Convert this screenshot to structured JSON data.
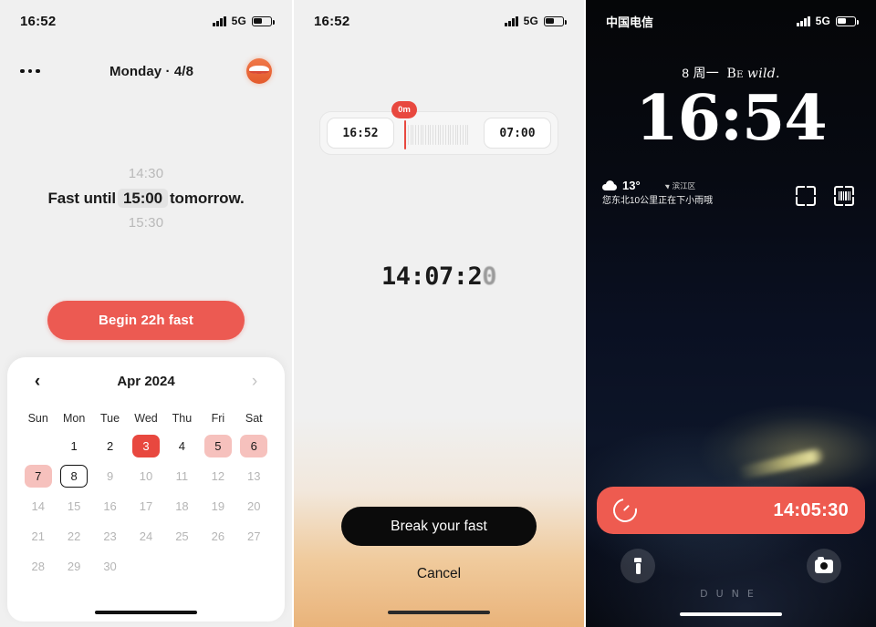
{
  "panel1": {
    "status": {
      "time": "16:52",
      "network": "5G"
    },
    "topbar": {
      "menu_icon": "more-dots-icon",
      "date": "Monday · 4/8",
      "avatar_icon": "profile-avatar"
    },
    "fast_line": {
      "ghost_above": "14:30",
      "prefix": "Fast until",
      "selected_time": "15:00",
      "suffix": "tomorrow.",
      "ghost_below": "15:30"
    },
    "begin_button": "Begin 22h fast",
    "calendar": {
      "prev_icon": "chevron-left-icon",
      "next_icon": "chevron-right-icon",
      "title": "Apr 2024",
      "weekdays": [
        "Sun",
        "Mon",
        "Tue",
        "Wed",
        "Thu",
        "Fri",
        "Sat"
      ],
      "leading_blanks": 1,
      "days": [
        {
          "n": "1",
          "state": "normal"
        },
        {
          "n": "2",
          "state": "normal"
        },
        {
          "n": "3",
          "state": "full"
        },
        {
          "n": "4",
          "state": "normal"
        },
        {
          "n": "5",
          "state": "part"
        },
        {
          "n": "6",
          "state": "part"
        },
        {
          "n": "7",
          "state": "part"
        },
        {
          "n": "8",
          "state": "today"
        },
        {
          "n": "9",
          "state": "muted"
        },
        {
          "n": "10",
          "state": "muted"
        },
        {
          "n": "11",
          "state": "muted"
        },
        {
          "n": "12",
          "state": "muted"
        },
        {
          "n": "13",
          "state": "muted"
        },
        {
          "n": "14",
          "state": "muted"
        },
        {
          "n": "15",
          "state": "muted"
        },
        {
          "n": "16",
          "state": "muted"
        },
        {
          "n": "17",
          "state": "muted"
        },
        {
          "n": "18",
          "state": "muted"
        },
        {
          "n": "19",
          "state": "muted"
        },
        {
          "n": "20",
          "state": "muted"
        },
        {
          "n": "21",
          "state": "muted"
        },
        {
          "n": "22",
          "state": "muted"
        },
        {
          "n": "23",
          "state": "muted"
        },
        {
          "n": "24",
          "state": "muted"
        },
        {
          "n": "25",
          "state": "muted"
        },
        {
          "n": "26",
          "state": "muted"
        },
        {
          "n": "27",
          "state": "muted"
        },
        {
          "n": "28",
          "state": "muted"
        },
        {
          "n": "29",
          "state": "muted"
        },
        {
          "n": "30",
          "state": "muted"
        }
      ]
    }
  },
  "panel2": {
    "status": {
      "time": "16:52",
      "network": "5G"
    },
    "range": {
      "start_time": "16:52",
      "end_time": "07:00",
      "marker_badge": "0m",
      "tick_count": 26
    },
    "elapsed_timer": {
      "stable": "14:07:2",
      "rolling": "0"
    },
    "break_button": "Break your fast",
    "cancel_button": "Cancel"
  },
  "panel3": {
    "status": {
      "carrier": "中国电信",
      "network": "5G"
    },
    "header": {
      "date": "8 周一",
      "quote_small_caps": "Be",
      "quote_italic": "wild."
    },
    "clock": "16:54",
    "weather": {
      "icon": "cloud-icon",
      "temperature": "13°",
      "location": "滨江区",
      "description": "您东北10公里正在下小雨哦"
    },
    "widgets": [
      {
        "icon": "scan-frame-icon"
      },
      {
        "icon": "barcode-scan-icon"
      }
    ],
    "live_activity": {
      "icon": "fasting-timer-icon",
      "time": "14:05:30"
    },
    "actions": {
      "flashlight_icon": "flashlight-icon",
      "camera_icon": "camera-icon"
    },
    "wallpaper_text": "DUNE"
  },
  "colors": {
    "accent_red": "#ec5a52",
    "calendar_full": "#e8483f",
    "calendar_part": "#f6c1bd",
    "dark_button": "#0b0b0b"
  }
}
